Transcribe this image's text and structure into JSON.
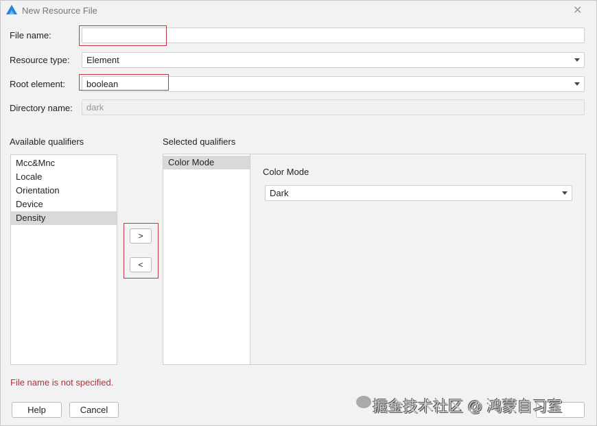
{
  "window": {
    "title": "New Resource File",
    "logo_color": "#2e7fd6"
  },
  "form": {
    "file_name": {
      "label": "File name:",
      "value": ""
    },
    "resource_type": {
      "label": "Resource type:",
      "value": "Element"
    },
    "root_element": {
      "label": "Root element:",
      "value": "boolean"
    },
    "directory_name": {
      "label": "Directory name:",
      "value": "dark"
    }
  },
  "qualifiers": {
    "available_label": "Available qualifiers",
    "available": [
      "Mcc&Mnc",
      "Locale",
      "Orientation",
      "Device",
      "Density"
    ],
    "selected_label": "Selected qualifiers",
    "selected": [
      "Color Mode"
    ],
    "add_label": ">",
    "remove_label": "<",
    "detail": {
      "label": "Color Mode",
      "value": "Dark"
    }
  },
  "error": "File name is not specified.",
  "footer": {
    "help": "Help",
    "cancel": "Cancel"
  },
  "watermark": "掘金技术社区 @ 鸿蒙自习室",
  "colors": {
    "highlight": "#c0383f",
    "error": "#b0303a"
  }
}
